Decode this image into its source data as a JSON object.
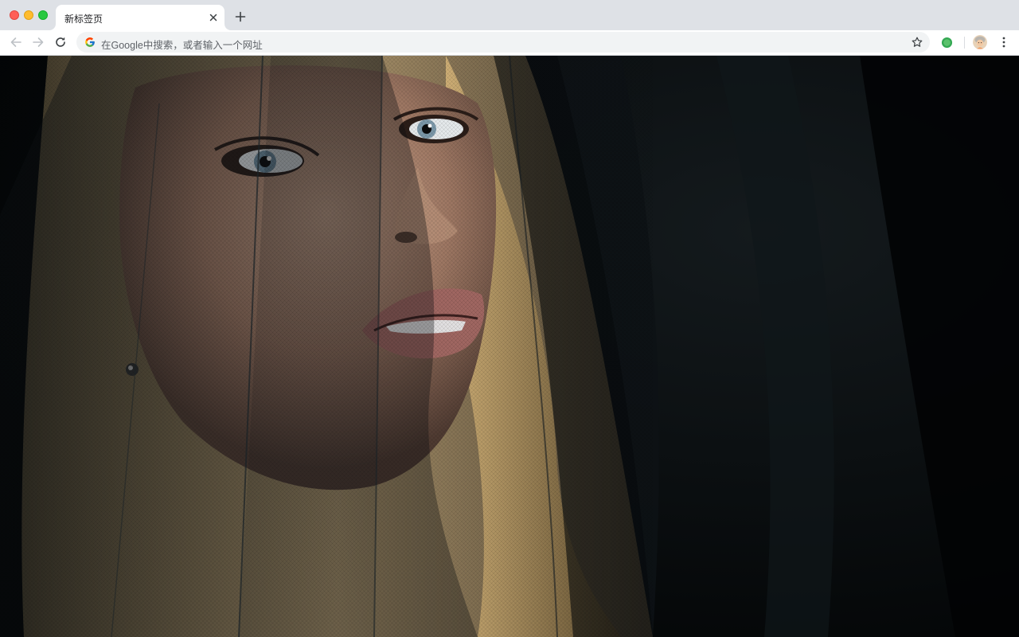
{
  "window": {
    "controls": [
      "close",
      "minimize",
      "maximize"
    ]
  },
  "tabs": [
    {
      "title": "新标签页",
      "active": true,
      "close_icon": "close-icon"
    }
  ],
  "new_tab_icon": "plus-icon",
  "toolbar": {
    "back_icon": "arrow-left-icon",
    "forward_icon": "arrow-right-icon",
    "reload_icon": "reload-icon",
    "omnibox": {
      "engine_icon": "google-g-icon",
      "value": "",
      "placeholder": "在Google中搜索，或者输入一个网址"
    },
    "bookmark_icon": "star-outline-icon",
    "extension_icon": "green-circle-extension-icon",
    "profile_icon": "avatar-icon",
    "menu_icon": "three-dots-vertical-icon"
  },
  "content": {
    "type": "wallpaper-photo",
    "subject": "photo"
  },
  "colors": {
    "tabstrip_bg": "#dee1e6",
    "toolbar_bg": "#ffffff",
    "omnibox_bg": "#f1f3f4",
    "text_primary": "#202124",
    "text_secondary": "#5f6368",
    "close_red": "#ff5f57",
    "minimize_yellow": "#febc2e",
    "maximize_green": "#28c840",
    "extension_green": "#34a853"
  }
}
